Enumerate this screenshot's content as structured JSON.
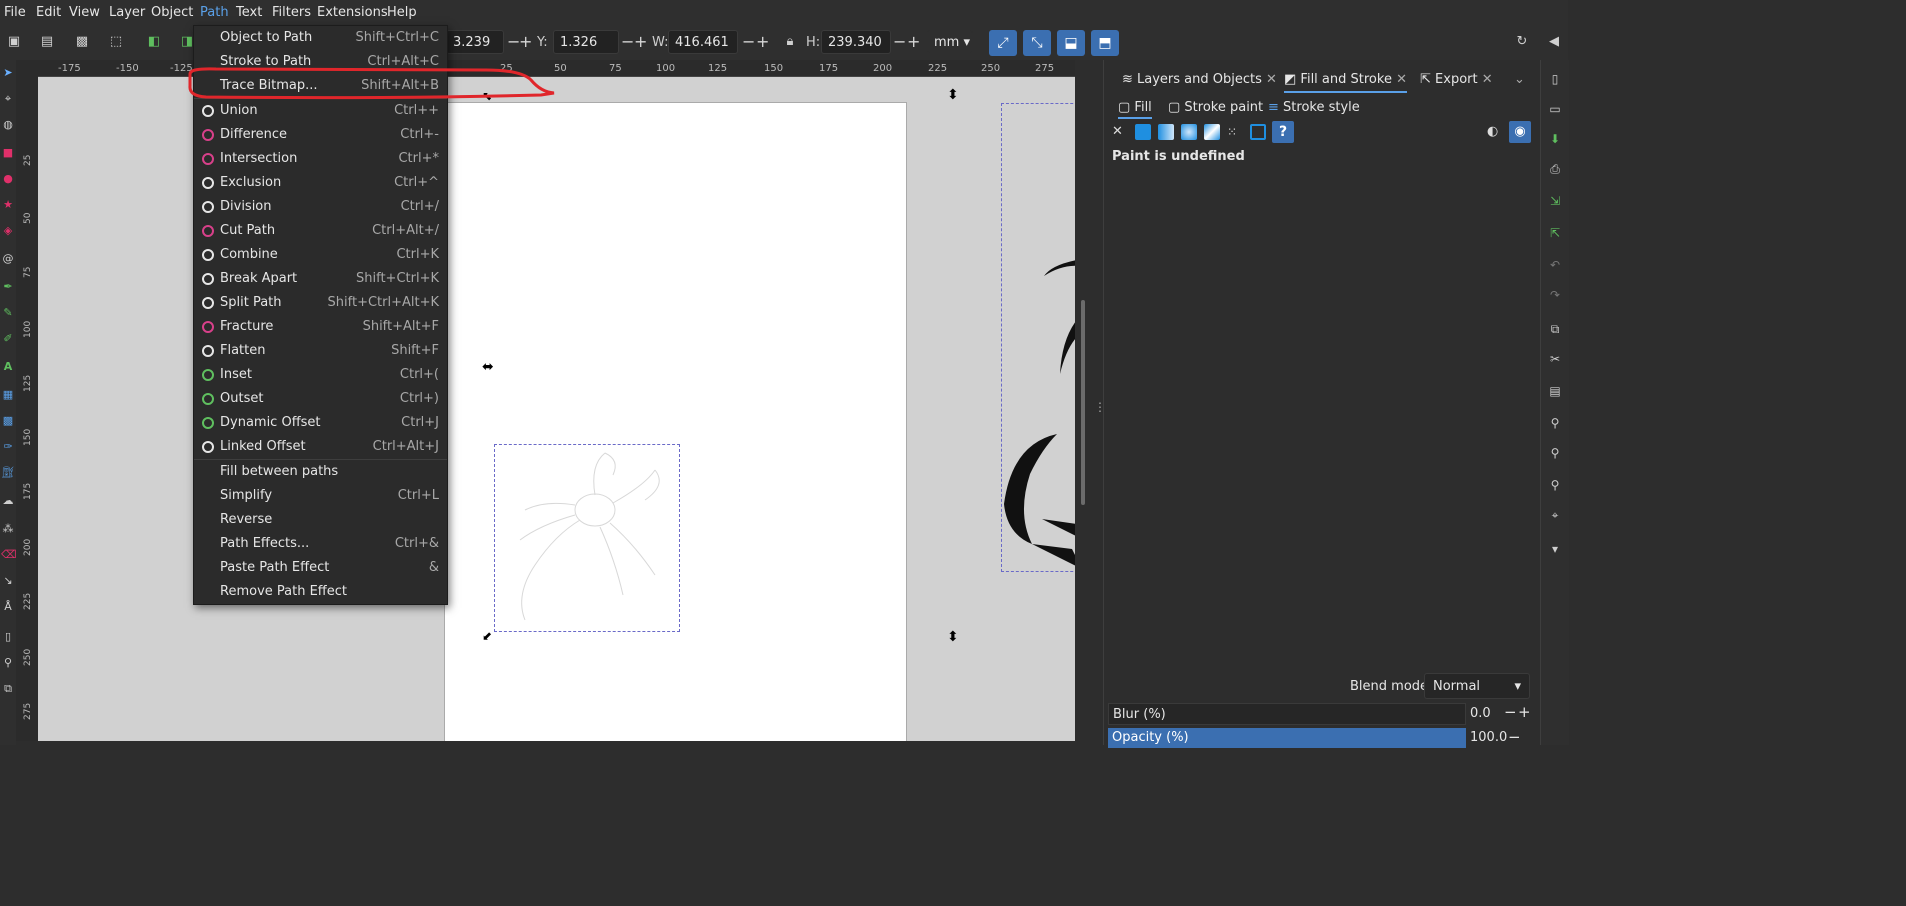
{
  "menubar": {
    "items": [
      "File",
      "Edit",
      "View",
      "Layer",
      "Object",
      "Path",
      "Text",
      "Filters",
      "Extensions",
      "Help"
    ],
    "active": "Path"
  },
  "toolbar": {
    "x_value": "3.239",
    "y_label": "Y:",
    "y_value": "1.326",
    "w_label": "W:",
    "w_value": "416.461",
    "h_label": "H:",
    "h_value": "239.340",
    "unit": "mm"
  },
  "ruler": {
    "h_ticks": [
      "-175",
      "-150",
      "-125",
      "25",
      "50",
      "75",
      "100",
      "125",
      "150",
      "175",
      "200",
      "225",
      "250",
      "275"
    ],
    "v_ticks": [
      "25",
      "50",
      "75",
      "100",
      "125",
      "150",
      "175",
      "200",
      "225",
      "250",
      "275"
    ]
  },
  "path_menu": {
    "items": [
      {
        "label": "Object to Path",
        "shortcut": "Shift+Ctrl+C",
        "icon": ""
      },
      {
        "label": "Stroke to Path",
        "shortcut": "Ctrl+Alt+C",
        "icon": ""
      },
      {
        "label": "Trace Bitmap...",
        "shortcut": "Shift+Alt+B",
        "icon": ""
      },
      {
        "label": "Union",
        "shortcut": "Ctrl++",
        "icon": "union-icon"
      },
      {
        "label": "Difference",
        "shortcut": "Ctrl+-",
        "icon": "difference-icon"
      },
      {
        "label": "Intersection",
        "shortcut": "Ctrl+*",
        "icon": "intersection-icon"
      },
      {
        "label": "Exclusion",
        "shortcut": "Ctrl+^",
        "icon": "exclusion-icon"
      },
      {
        "label": "Division",
        "shortcut": "Ctrl+/",
        "icon": "division-icon"
      },
      {
        "label": "Cut Path",
        "shortcut": "Ctrl+Alt+/",
        "icon": "cut-path-icon"
      },
      {
        "label": "Combine",
        "shortcut": "Ctrl+K",
        "icon": "combine-icon"
      },
      {
        "label": "Break Apart",
        "shortcut": "Shift+Ctrl+K",
        "icon": "break-apart-icon"
      },
      {
        "label": "Split Path",
        "shortcut": "Shift+Ctrl+Alt+K",
        "icon": "split-path-icon"
      },
      {
        "label": "Fracture",
        "shortcut": "Shift+Alt+F",
        "icon": "fracture-icon"
      },
      {
        "label": "Flatten",
        "shortcut": "Shift+F",
        "icon": "flatten-icon"
      },
      {
        "label": "Inset",
        "shortcut": "Ctrl+(",
        "icon": "inset-icon"
      },
      {
        "label": "Outset",
        "shortcut": "Ctrl+)",
        "icon": "outset-icon"
      },
      {
        "label": "Dynamic Offset",
        "shortcut": "Ctrl+J",
        "icon": "dynamic-offset-icon"
      },
      {
        "label": "Linked Offset",
        "shortcut": "Ctrl+Alt+J",
        "icon": "linked-offset-icon"
      },
      {
        "label": "Fill between paths",
        "shortcut": "",
        "icon": ""
      },
      {
        "label": "Simplify",
        "shortcut": "Ctrl+L",
        "icon": ""
      },
      {
        "label": "Reverse",
        "shortcut": "",
        "icon": ""
      },
      {
        "label": "Path Effects...",
        "shortcut": "Ctrl+&",
        "icon": ""
      },
      {
        "label": "Paste Path Effect",
        "shortcut": "&",
        "icon": ""
      },
      {
        "label": "Remove Path Effect",
        "shortcut": "",
        "icon": ""
      }
    ],
    "highlighted": "Trace Bitmap..."
  },
  "dock": {
    "tabs": [
      "Layers and Objects",
      "Fill and Stroke",
      "Export"
    ],
    "active_tab": "Fill and Stroke",
    "subtabs": [
      "Fill",
      "Stroke paint",
      "Stroke style"
    ],
    "paint_status": "Paint is undefined",
    "blend_label": "Blend mode:",
    "blend_value": "Normal",
    "blur_label": "Blur (%)",
    "blur_value": "0.0",
    "opacity_label": "Opacity (%)",
    "opacity_value": "100.0"
  },
  "colors": {
    "accent": "#3b6fb1",
    "annotation_red": "#e0262b",
    "menu_bg": "#2b2b2b"
  }
}
